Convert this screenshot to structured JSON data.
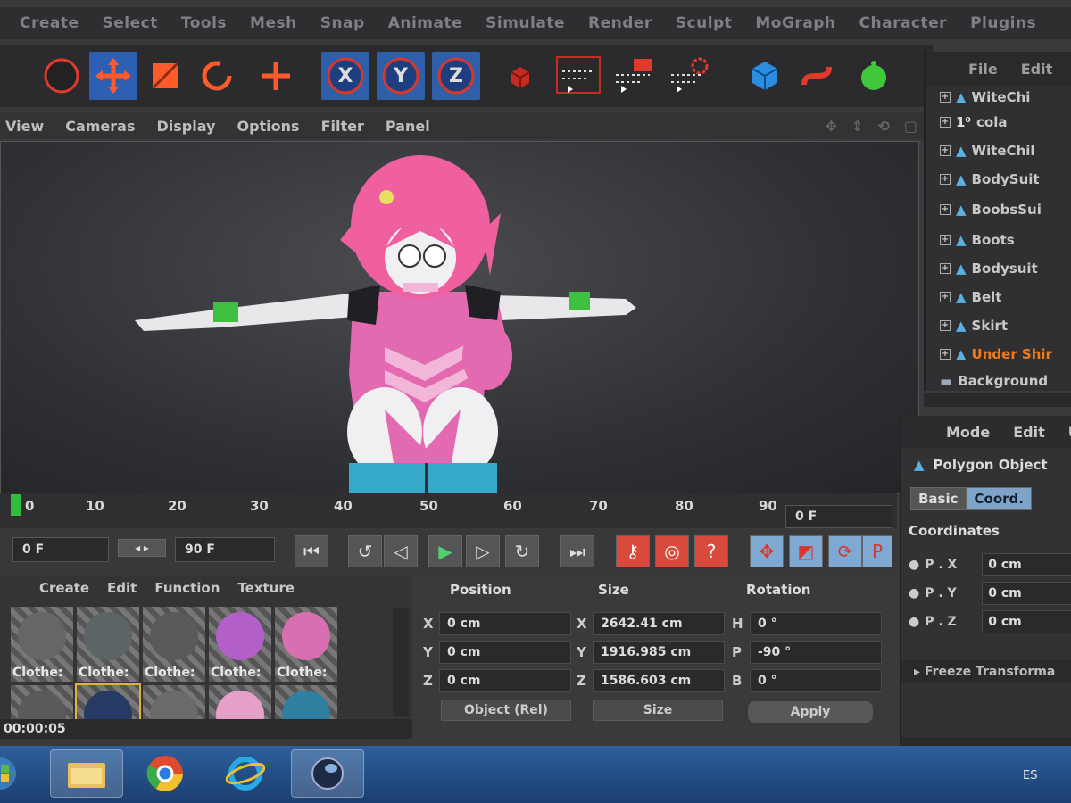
{
  "menubar": {
    "items": [
      "Create",
      "Select",
      "Tools",
      "Mesh",
      "Snap",
      "Animate",
      "Simulate",
      "Render",
      "Sculpt",
      "MoGraph",
      "Character",
      "Plugins"
    ]
  },
  "toolbar": {
    "tools": [
      {
        "name": "live-selection-tool-icon",
        "active": false
      },
      {
        "name": "move-tool-icon",
        "active": true
      },
      {
        "name": "scale-tool-icon",
        "active": false
      },
      {
        "name": "rotate-tool-icon",
        "active": false
      },
      {
        "name": "add-tool-icon",
        "active": false
      },
      {
        "name": "x-axis-lock-icon",
        "label": "X",
        "active": true
      },
      {
        "name": "y-axis-lock-icon",
        "label": "Y",
        "active": true
      },
      {
        "name": "z-axis-lock-icon",
        "label": "Z",
        "active": true
      },
      {
        "name": "coordinate-system-icon",
        "active": false
      },
      {
        "name": "render-region-icon",
        "active": false
      },
      {
        "name": "render-view-icon",
        "active": false
      },
      {
        "name": "render-settings-icon",
        "active": false
      },
      {
        "name": "cube-primitive-icon",
        "active": false
      },
      {
        "name": "spline-icon",
        "active": false
      },
      {
        "name": "nurbs-icon",
        "active": false
      }
    ]
  },
  "viewport": {
    "menu": [
      "View",
      "Cameras",
      "Display",
      "Options",
      "Filter",
      "Panel"
    ]
  },
  "objects": {
    "menu": [
      "File",
      "Edit"
    ],
    "items": [
      {
        "label": "WiteChi",
        "active": false
      },
      {
        "label": "cola",
        "active": false
      },
      {
        "label": "WiteChil",
        "active": false
      },
      {
        "label": "BodySuit",
        "active": false
      },
      {
        "label": "BoobsSui",
        "active": false
      },
      {
        "label": "Boots",
        "active": false
      },
      {
        "label": "Bodysuit",
        "active": false
      },
      {
        "label": "Belt",
        "active": false
      },
      {
        "label": "Skirt",
        "active": false
      },
      {
        "label": "Under Shir",
        "active": true
      },
      {
        "label": "Background",
        "active": false
      }
    ]
  },
  "attributes": {
    "menu": [
      "Mode",
      "Edit",
      "U"
    ],
    "title": "Polygon Object",
    "tabs": [
      {
        "label": "Basic",
        "selected": false
      },
      {
        "label": "Coord.",
        "selected": true
      }
    ],
    "section": "Coordinates",
    "rows": [
      {
        "label": "P . X",
        "value": "0 cm"
      },
      {
        "label": "P . Y",
        "value": "0 cm"
      },
      {
        "label": "P . Z",
        "value": "0 cm"
      }
    ],
    "freeze": "Freeze Transforma"
  },
  "timeline": {
    "ticks": [
      "0",
      "10",
      "20",
      "30",
      "40",
      "50",
      "60",
      "70",
      "80",
      "90"
    ],
    "current_frame": "0 F"
  },
  "transport": {
    "start_frame": "0 F",
    "end_frame": "90 F"
  },
  "materials": {
    "menu": [
      "Create",
      "Edit",
      "Function",
      "Texture"
    ],
    "row1": [
      {
        "label": "Clothe:",
        "color": "#666666"
      },
      {
        "label": "Clothe:",
        "color": "#5c6466"
      },
      {
        "label": "Clothe:",
        "color": "#5a5a5c"
      },
      {
        "label": "Clothe:",
        "color": "#b35fc9"
      },
      {
        "label": "Clothe:",
        "color": "#d86fb0"
      }
    ],
    "row2": [
      {
        "color": "#5a5a5c"
      },
      {
        "color": "#263a66"
      },
      {
        "color": "#6a6a6c"
      },
      {
        "color": "#e6a0c8"
      },
      {
        "color": "#2f7fa0"
      }
    ],
    "time": "00:00:05"
  },
  "coordinates": {
    "headers": [
      "Position",
      "Size",
      "Rotation"
    ],
    "position": [
      {
        "axis": "X",
        "value": "0 cm"
      },
      {
        "axis": "Y",
        "value": "0 cm"
      },
      {
        "axis": "Z",
        "value": "0 cm"
      }
    ],
    "size": [
      {
        "axis": "X",
        "value": "2642.41 cm"
      },
      {
        "axis": "Y",
        "value": "1916.985 cm"
      },
      {
        "axis": "Z",
        "value": "1586.603 cm"
      }
    ],
    "rotation": [
      {
        "axis": "H",
        "value": "0 °"
      },
      {
        "axis": "P",
        "value": "-90 °"
      },
      {
        "axis": "B",
        "value": "0 °"
      }
    ],
    "mode_dropdown": "Object (Rel)",
    "size_dropdown": "Size",
    "apply": "Apply"
  },
  "taskbar": {
    "lang": "ES"
  }
}
